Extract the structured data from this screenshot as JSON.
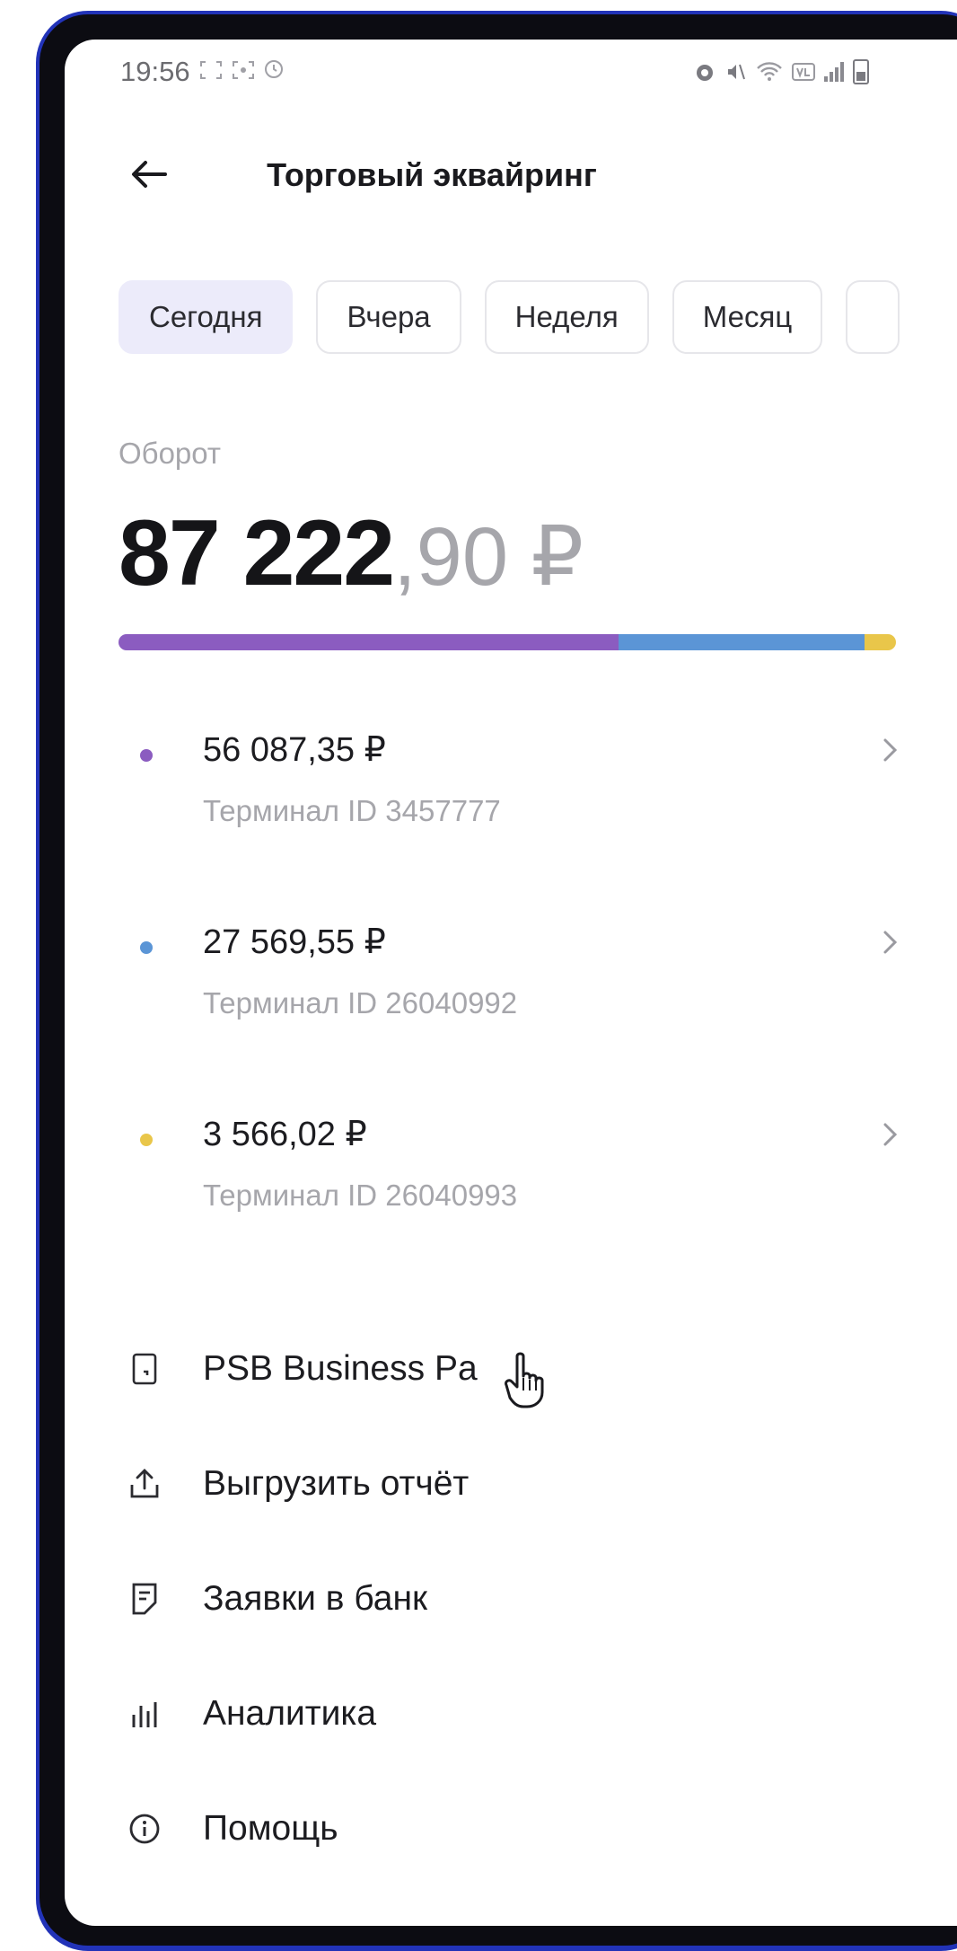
{
  "status_bar": {
    "time": "19:56",
    "left_icons": [
      "screenshot-icon",
      "focus-icon",
      "alarm-clock-icon"
    ],
    "right_icons": [
      "alarm-icon",
      "mute-icon",
      "wifi-icon",
      "volte-icon",
      "signal-icon",
      "battery-icon"
    ]
  },
  "header": {
    "title": "Торговый эквайринг"
  },
  "period_tabs": [
    {
      "label": "Сегодня",
      "active": true
    },
    {
      "label": "Вчера",
      "active": false
    },
    {
      "label": "Неделя",
      "active": false
    },
    {
      "label": "Месяц",
      "active": false
    }
  ],
  "turnover": {
    "label": "Оборот",
    "amount_main": "87 222",
    "amount_fraction": ",90 ₽",
    "segments": [
      {
        "value": 56087.35,
        "color": "#8b5cc0"
      },
      {
        "value": 27569.55,
        "color": "#5b95d6"
      },
      {
        "value": 3566.02,
        "color": "#e9c64a"
      }
    ]
  },
  "terminals": [
    {
      "amount": "56 087,35 ₽",
      "terminal": "Терминал ID 3457777",
      "color": "#8b5cc0"
    },
    {
      "amount": "27 569,55 ₽",
      "terminal": "Терминал ID 26040992",
      "color": "#5b95d6"
    },
    {
      "amount": "3 566,02 ₽",
      "terminal": "Терминал ID 26040993",
      "color": "#e9c64a"
    }
  ],
  "menu": [
    {
      "label": "PSB Business Pa",
      "icon": "phone-pay-icon"
    },
    {
      "label": "Выгрузить отчёт",
      "icon": "upload-icon"
    },
    {
      "label": "Заявки в банк",
      "icon": "document-icon"
    },
    {
      "label": "Аналитика",
      "icon": "analytics-icon"
    },
    {
      "label": "Помощь",
      "icon": "info-icon"
    }
  ]
}
